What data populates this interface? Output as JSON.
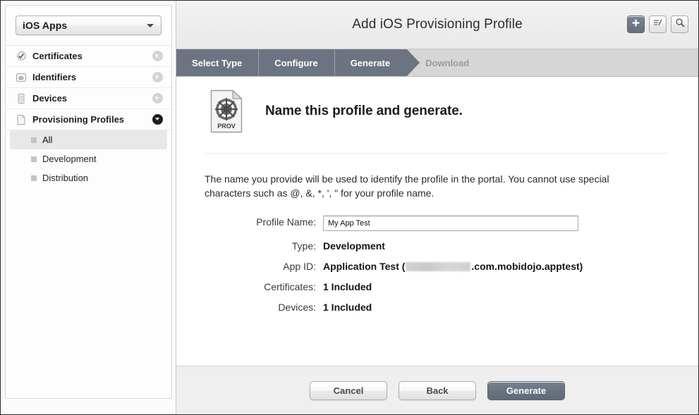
{
  "window": {
    "title": "Add iOS Provisioning Profile"
  },
  "sidebar": {
    "scope_select": {
      "label": "iOS Apps",
      "caret_icon": "chevron-down-icon"
    },
    "items": [
      {
        "label": "Certificates",
        "icon": "certificate-seal-icon",
        "disclosure": "chevron-right-icon",
        "expanded": false
      },
      {
        "label": "Identifiers",
        "icon": "id-badge-icon",
        "disclosure": "chevron-right-icon",
        "expanded": false
      },
      {
        "label": "Devices",
        "icon": "phone-icon",
        "disclosure": "chevron-right-icon",
        "expanded": false
      },
      {
        "label": "Provisioning Profiles",
        "icon": "document-icon",
        "disclosure": "chevron-down-icon",
        "expanded": true
      }
    ],
    "subitems": [
      {
        "label": "All",
        "selected": true
      },
      {
        "label": "Development",
        "selected": false
      },
      {
        "label": "Distribution",
        "selected": false
      }
    ]
  },
  "toolbar": {
    "add_label": "plus-icon",
    "edit_label": "edit-pencil-icon",
    "search_label": "search-icon"
  },
  "steps": [
    {
      "label": "Select Type",
      "state": "done"
    },
    {
      "label": "Configure",
      "state": "done"
    },
    {
      "label": "Generate",
      "state": "current"
    },
    {
      "label": "Download",
      "state": "upcoming"
    }
  ],
  "main": {
    "icon_badge_text": "PROV",
    "icon_name": "provisioning-profile-document-icon",
    "heading": "Name this profile and generate.",
    "description": "The name you provide will be used to identify the profile in the portal. You cannot use special characters such as @, &, *, ', \" for your profile name."
  },
  "form": {
    "rows": [
      {
        "label": "Profile Name:",
        "value": "My App Test",
        "type": "input",
        "placeholder": ""
      },
      {
        "label": "Type:",
        "value": "Development",
        "type": "text"
      },
      {
        "label": "App ID:",
        "value_prefix": "Application Test (",
        "value_redacted": true,
        "value_suffix": ".com.mobidojo.apptest)",
        "type": "redacted"
      },
      {
        "label": "Certificates:",
        "value": "1 Included",
        "type": "text"
      },
      {
        "label": "Devices:",
        "value": "1 Included",
        "type": "text"
      }
    ]
  },
  "footer": {
    "cancel_label": "Cancel",
    "back_label": "Back",
    "generate_label": "Generate"
  },
  "colors": {
    "accent": "#6b7480",
    "step_active_bg": "#6b7480",
    "step_bar_bg": "#d6d6d6",
    "footer_bg": "#efefef",
    "sidebar_bg": "#fbfbfb"
  }
}
